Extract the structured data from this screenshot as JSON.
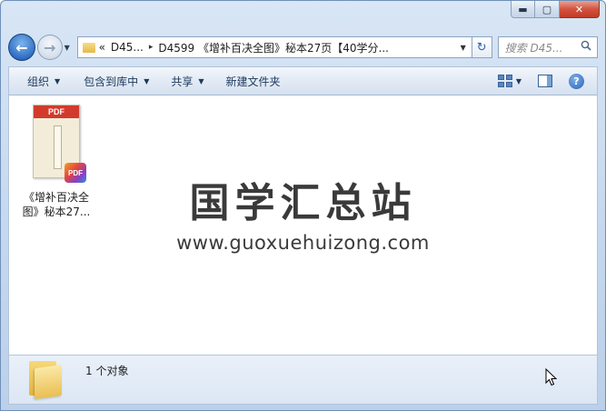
{
  "titlebar": {
    "minimize_glyph": "▬",
    "maximize_glyph": "▢",
    "close_glyph": "✕"
  },
  "nav": {
    "back_glyph": "←",
    "forward_glyph": "→",
    "history_caret": "▼"
  },
  "address": {
    "chevron": "«",
    "crumb_1": "D45...",
    "separator": "▸",
    "crumb_2": "D4599 《增补百决全图》秘本27页【40学分...",
    "dropdown_caret": "▼",
    "refresh_glyph": "↻"
  },
  "search": {
    "placeholder": "搜索 D45...",
    "icon_glyph": "🔍"
  },
  "commands": {
    "organize": "组织",
    "include_in_library": "包含到库中",
    "share": "共享",
    "new_folder": "新建文件夹",
    "caret": "▼",
    "help_glyph": "?"
  },
  "files": [
    {
      "name": "《增补百决全图》秘本27...",
      "thumb_banner": "PDF",
      "badge": "PDF"
    }
  ],
  "watermark": {
    "title": "国学汇总站",
    "url": "www.guoxuehuizong.com"
  },
  "details": {
    "count_text": "1 个对象"
  },
  "colors": {
    "accent": "#2f6fc4",
    "pdf_red": "#d23a2c",
    "folder_yellow": "#e9bf52"
  }
}
